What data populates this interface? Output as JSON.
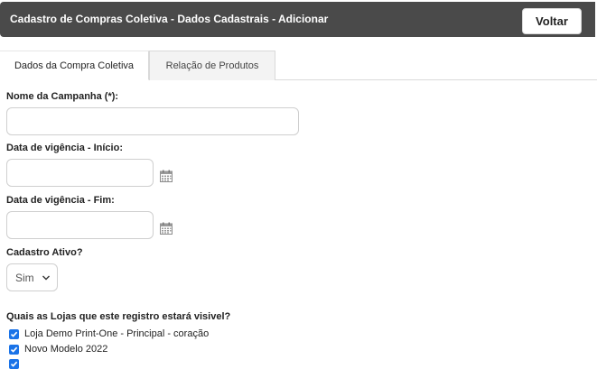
{
  "header": {
    "title": "Cadastro de Compras Coletiva - Dados Cadastrais - Adicionar",
    "back_button": "Voltar"
  },
  "tabs": [
    {
      "label": "Dados da Compra Coletiva",
      "active": true
    },
    {
      "label": "Relação de Produtos",
      "active": false
    }
  ],
  "form": {
    "campaign_name_label": "Nome da Campanha (*):",
    "campaign_name_value": "",
    "start_date_label": "Data de vigência - Início:",
    "start_date_value": "",
    "end_date_label": "Data de vigência - Fim:",
    "end_date_value": "",
    "active_label": "Cadastro Ativo?",
    "active_value": "Sim",
    "stores_label": "Quais as Lojas que este registro estará visivel?",
    "stores": [
      {
        "label": "Loja Demo Print-One - Principal - coração",
        "checked": true
      },
      {
        "label": "Novo Modelo 2022",
        "checked": true
      },
      {
        "label": "",
        "checked": true
      }
    ]
  },
  "colors": {
    "header_bg": "#4a4a4a",
    "checkbox_accent": "#1a73e8"
  },
  "icons": {
    "date_picker": "calendar-icon",
    "select_arrow": "chevron-down-icon",
    "checkbox": "checkmark-icon"
  }
}
